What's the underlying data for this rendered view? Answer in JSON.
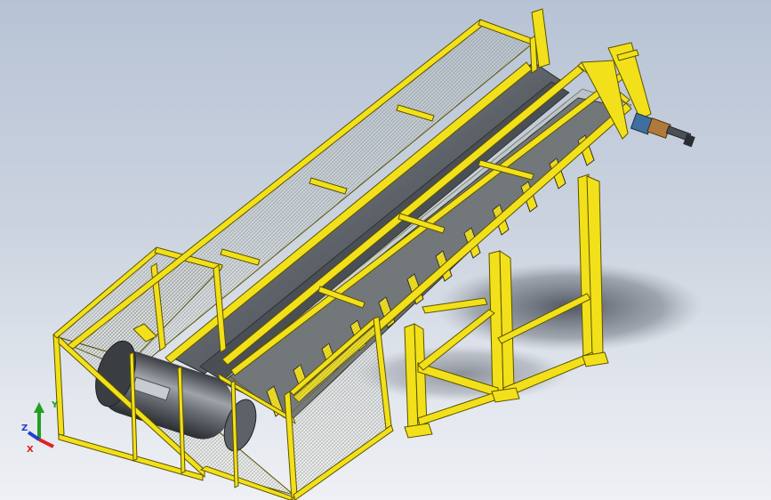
{
  "viewport": {
    "background_top": "#b7c3d5",
    "background_bottom": "#eef0f4"
  },
  "model": {
    "frame_color": "#f2e01a",
    "frame_edge_color": "#5a5200",
    "mesh_color": "#9a9a7a",
    "metal_color": "#6f747b",
    "shaft_color": "#4a4f56"
  },
  "triad": {
    "x_label": "X",
    "y_label": "Y",
    "z_label": "Z",
    "x_color": "#e02020",
    "y_color": "#20a020",
    "z_color": "#2040d0"
  }
}
